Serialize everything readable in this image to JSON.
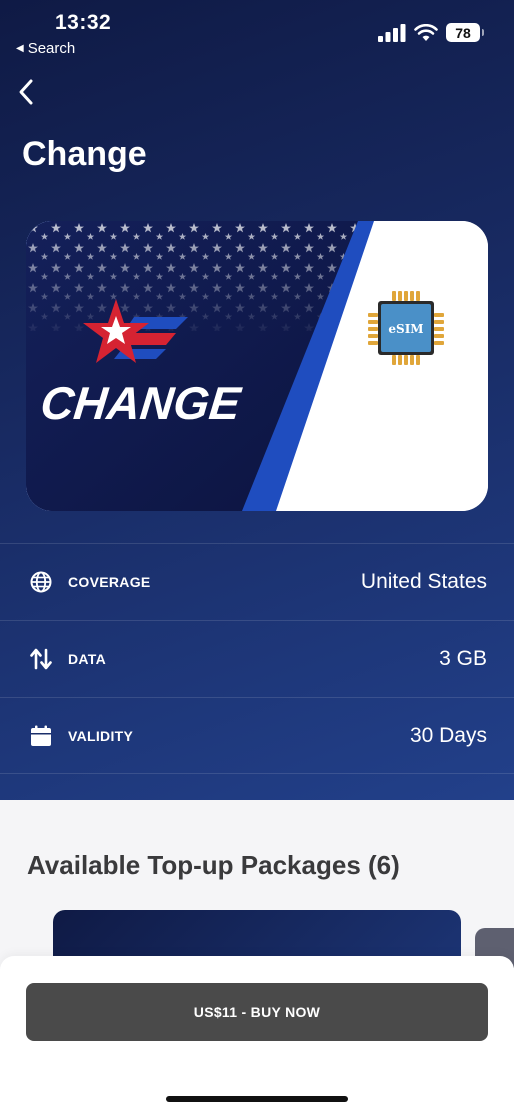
{
  "status_bar": {
    "time": "13:32",
    "back_app_label": "Search",
    "battery_level": "78",
    "icons": [
      "signal-icon",
      "wifi-icon",
      "battery-icon"
    ]
  },
  "header": {
    "title": "Change",
    "back_icon": "chevron-left-icon"
  },
  "card": {
    "brand_text": "CHANGE",
    "chip_label": "eSIM",
    "colors": {
      "navy": "#101a4a",
      "blue_stripe": "#1f4dbf",
      "red": "#d62332",
      "chip_blue": "#4a90c8",
      "chip_gold": "#e0a63a"
    }
  },
  "details": [
    {
      "icon": "globe-icon",
      "label": "COVERAGE",
      "value": "United States"
    },
    {
      "icon": "arrows-up-down-icon",
      "label": "DATA",
      "value": "3 GB"
    },
    {
      "icon": "calendar-icon",
      "label": "VALIDITY",
      "value": "30 Days"
    }
  ],
  "packages": {
    "title": "Available Top-up Packages (6)"
  },
  "footer": {
    "buy_label": "US$11 - BUY NOW"
  }
}
